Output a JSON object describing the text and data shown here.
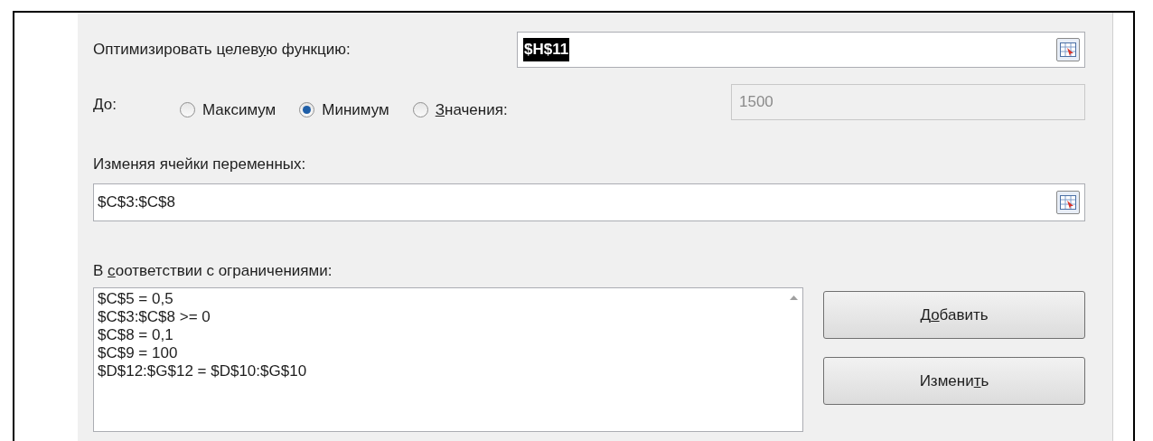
{
  "objective": {
    "label": {
      "before": "Оптимизировать целев",
      "key": "у",
      "after": "ю функцию:"
    },
    "value": "$H$11",
    "value_selected": true
  },
  "target": {
    "label": "До:",
    "options": [
      {
        "label": "Максимум",
        "selected": false
      },
      {
        "label": "Минимум",
        "selected": true
      },
      {
        "label": {
          "key": "З",
          "after": "начения:"
        },
        "selected": false
      }
    ],
    "value": "1500",
    "disabled": true
  },
  "variables": {
    "label": "Изменяя ячейки переменных:",
    "value": "$C$3:$C$8"
  },
  "constraints": {
    "label": {
      "before": "В ",
      "key": "с",
      "after": "оответствии с ограничениями:"
    },
    "items": [
      "$C$5 = 0,5",
      "$C$3:$C$8 >= 0",
      "$C$8 = 0,1",
      "$C$9 = 100",
      "$D$12:$G$12 = $D$10:$G$10"
    ],
    "buttons": [
      {
        "before": "Д",
        "key": "о",
        "after": "бавить"
      },
      {
        "before": "Измени",
        "key": "т",
        "after": "ь"
      }
    ]
  }
}
